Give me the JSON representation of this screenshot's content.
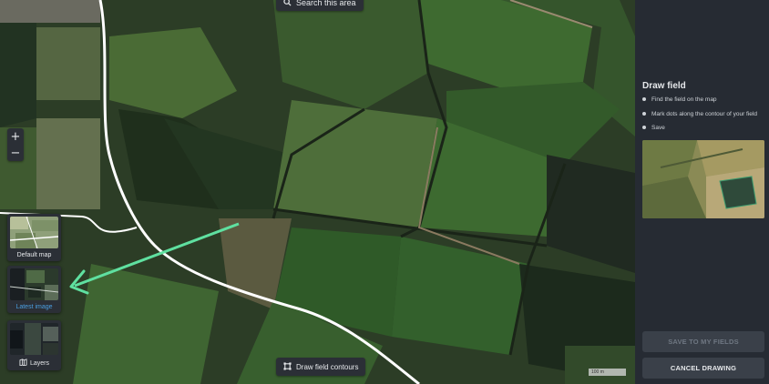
{
  "map": {
    "search_label": "Search this area",
    "zoom_in": "+",
    "zoom_out": "−",
    "layers": [
      {
        "label": "Default map",
        "active": false
      },
      {
        "label": "Latest image",
        "active": true
      },
      {
        "label": "Layers",
        "active": false
      }
    ],
    "draw_label": "Draw field contours",
    "scale_label": "100 m",
    "arrow_color": "#5fe0a0"
  },
  "panel": {
    "title": "Draw field",
    "steps": [
      "Find the field on the map",
      "Mark dots along the contour of your field",
      "Save"
    ],
    "save_label": "SAVE TO MY FIELDS",
    "cancel_label": "CANCEL DRAWING"
  }
}
